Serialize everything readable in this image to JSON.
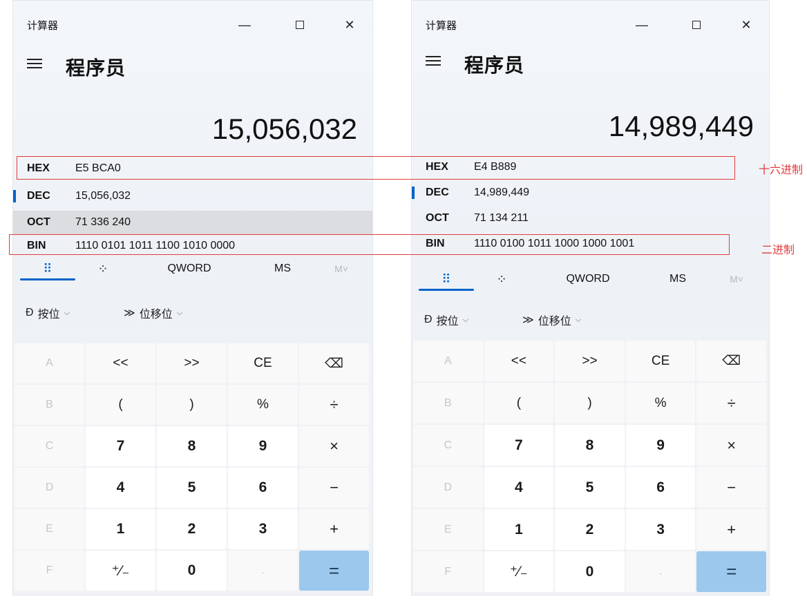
{
  "calculators": [
    {
      "window_title": "计算器",
      "mode_title": "程序员",
      "display": "15,056,032",
      "bases": [
        {
          "label": "HEX",
          "value": "E5 BCA0"
        },
        {
          "label": "DEC",
          "value": "15,056,032"
        },
        {
          "label": "OCT",
          "value": "71 336 240"
        },
        {
          "label": "BIN",
          "value": "1110 0101 1011 1100 1010 0000"
        }
      ]
    },
    {
      "window_title": "计算器",
      "mode_title": "程序员",
      "display": "14,989,449",
      "bases": [
        {
          "label": "HEX",
          "value": "E4 B889"
        },
        {
          "label": "DEC",
          "value": "14,989,449"
        },
        {
          "label": "OCT",
          "value": "71 134 211"
        },
        {
          "label": "BIN",
          "value": "1110 0100 1011 1000 1000 1001"
        }
      ]
    }
  ],
  "tabs": {
    "word_size": "QWORD",
    "ms": "MS",
    "m": "M˅"
  },
  "bitwise": {
    "label": "按位",
    "shift": "位移位"
  },
  "keys": {
    "A": "A",
    "lsh": "<<",
    "rsh": ">>",
    "CE": "CE",
    "B": "B",
    "lp": "(",
    "rp": ")",
    "pct": "%",
    "div": "÷",
    "C": "C",
    "k7": "7",
    "k8": "8",
    "k9": "9",
    "mul": "×",
    "D": "D",
    "k4": "4",
    "k5": "5",
    "k6": "6",
    "sub": "−",
    "E": "E",
    "k1": "1",
    "k2": "2",
    "k3": "3",
    "add": "+",
    "F": "F",
    "neg": "⁺∕₋",
    "k0": "0",
    "dot": ".",
    "eq": "="
  },
  "annotations": {
    "hex": "十六进制",
    "bin": "二进制"
  },
  "colors": {
    "accent": "#0063c8",
    "equals": "#9cc8ee",
    "annotation": "#e23b3b"
  }
}
